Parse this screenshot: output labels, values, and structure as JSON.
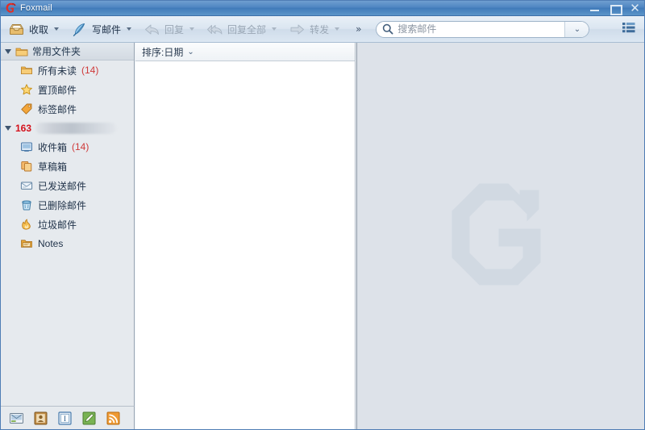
{
  "window": {
    "title": "Foxmail",
    "logo_icon": "foxmail-g-logo",
    "controls": [
      {
        "name": "minimize",
        "label": "—"
      },
      {
        "name": "maximize",
        "label": "□"
      },
      {
        "name": "close",
        "label": "✕"
      }
    ]
  },
  "toolbar": {
    "buttons": [
      {
        "label": "收取",
        "icon": "inbox-tray-icon",
        "has_caret": true,
        "disabled": false
      },
      {
        "label": "写邮件",
        "icon": "quill-pen-icon",
        "has_caret": true,
        "disabled": false
      },
      {
        "label": "回复",
        "icon": "reply-arrow-icon",
        "has_caret": true,
        "disabled": true
      },
      {
        "label": "回复全部",
        "icon": "reply-all-arrow-icon",
        "has_caret": true,
        "disabled": true
      },
      {
        "label": "转发",
        "icon": "forward-arrow-icon",
        "has_caret": true,
        "disabled": true
      }
    ],
    "overflow_label": "»",
    "layout_toggle_icon": "list-layout-icon"
  },
  "search": {
    "placeholder": "搜索邮件",
    "value": "",
    "icon": "search-icon",
    "dropdown_icon": "chevron-double-down-icon"
  },
  "sidebar": {
    "favorites_group": {
      "label": "常用文件夹",
      "expanded": true,
      "icon": "folder-icon",
      "items": [
        {
          "label": "所有未读",
          "count": "(14)",
          "icon": "folder-icon"
        },
        {
          "label": "置顶邮件",
          "count": "",
          "icon": "star-icon"
        },
        {
          "label": "标签邮件",
          "count": "",
          "icon": "tag-icon"
        }
      ]
    },
    "account": {
      "provider": "163",
      "address_redacted": true,
      "expanded": true,
      "items": [
        {
          "label": "收件箱",
          "count": "(14)",
          "icon": "inbox-icon"
        },
        {
          "label": "草稿箱",
          "count": "",
          "icon": "drafts-icon"
        },
        {
          "label": "已发送邮件",
          "count": "",
          "icon": "sent-icon"
        },
        {
          "label": "已删除邮件",
          "count": "",
          "icon": "trash-icon"
        },
        {
          "label": "垃圾邮件",
          "count": "",
          "icon": "junk-icon"
        },
        {
          "label": "Notes",
          "count": "",
          "icon": "notes-folder-icon"
        }
      ]
    }
  },
  "message_list": {
    "sort_label": "排序:日期",
    "sort_chevron": "⌄",
    "items": []
  },
  "preview": {
    "watermark_icon": "foxmail-g-watermark",
    "empty": true
  },
  "bottom_bar": {
    "buttons": [
      {
        "name": "mail-module",
        "icon": "mail-icon"
      },
      {
        "name": "contacts-module",
        "icon": "contacts-icon"
      },
      {
        "name": "info-module",
        "icon": "info-card-icon"
      },
      {
        "name": "notes-module",
        "icon": "pencil-note-icon"
      },
      {
        "name": "rss-module",
        "icon": "rss-icon"
      }
    ]
  },
  "colors": {
    "titlebar_blue": "#4f86c2",
    "toolbar_bg": "#dbe6f1",
    "sidebar_bg": "#e6eaee",
    "list_bg": "#ffffff",
    "preview_bg": "#dde2e9",
    "accent_red": "#d4111b",
    "count_red": "#cf3a3a"
  }
}
